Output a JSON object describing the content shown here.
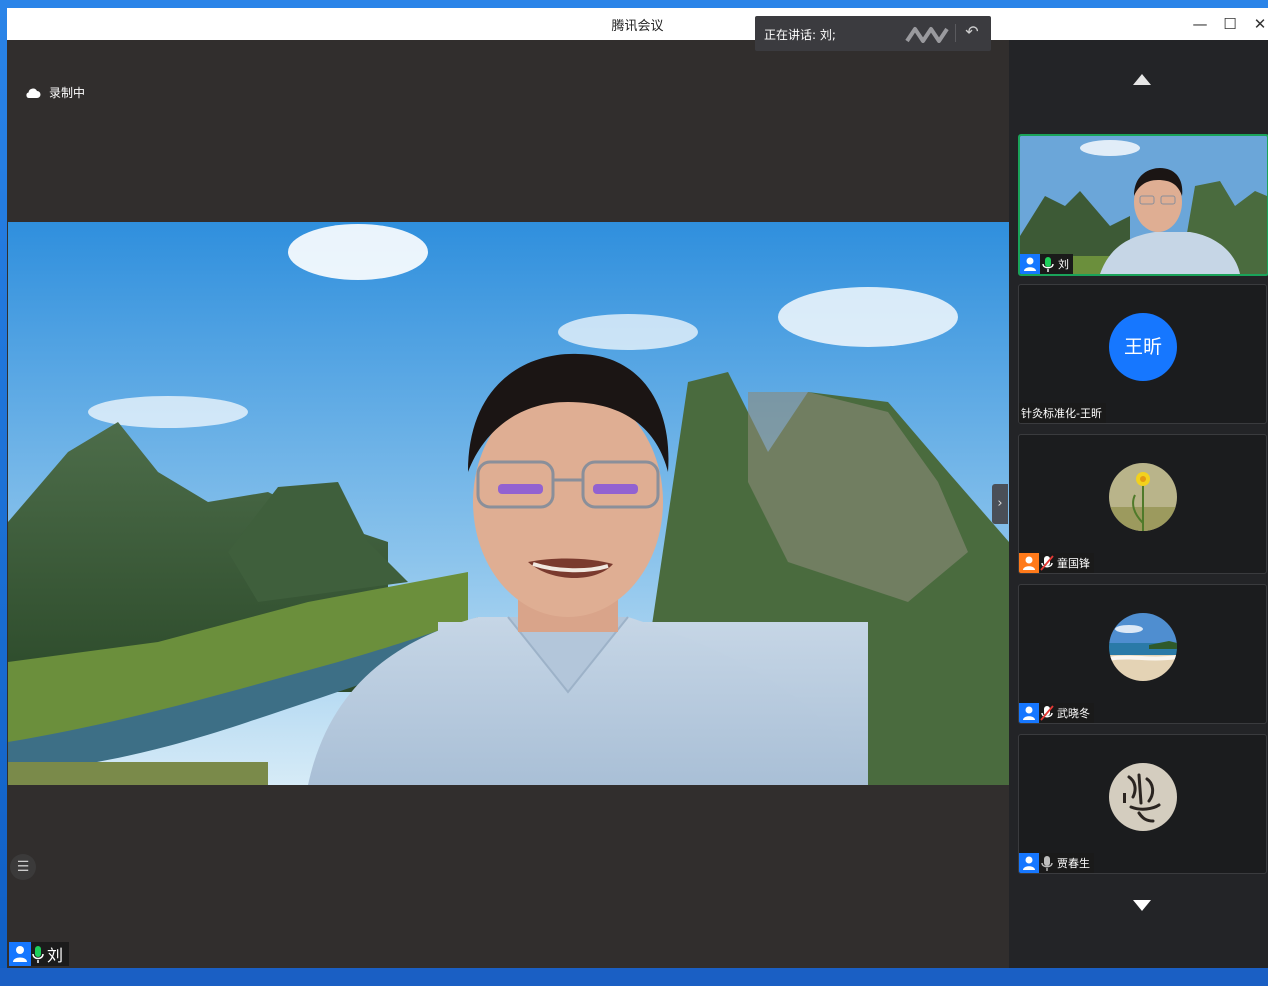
{
  "window": {
    "title": "腾讯会议",
    "controls": [
      "minimize-icon",
      "maximize-icon",
      "close-icon"
    ]
  },
  "speaking": {
    "label": "正在讲话: 刘;"
  },
  "recording": {
    "label": "录制中"
  },
  "main_video": {
    "participant_name": "刘"
  },
  "sidebar": {
    "participants": [
      {
        "name": "刘",
        "mic": "on",
        "role_color": "#1677ff",
        "active": true
      },
      {
        "name": "针灸标准化-王昕",
        "avatar_text": "王昕",
        "mic": "none",
        "active": false
      },
      {
        "name": "童国锋",
        "mic": "muted",
        "role_color": "#ff7a1a",
        "avatar": "daffodil",
        "active": false
      },
      {
        "name": "武晓冬",
        "mic": "muted",
        "role_color": "#1677ff",
        "avatar": "beach",
        "active": false
      },
      {
        "name": "贾春生",
        "mic": "off",
        "role_color": "#1677ff",
        "avatar": "calligraphy",
        "active": false
      }
    ]
  },
  "colors": {
    "accent": "#1677ff",
    "active_border": "#1aa35a",
    "host_badge": "#ff7a1a",
    "mic_on": "#1ecf5b"
  }
}
